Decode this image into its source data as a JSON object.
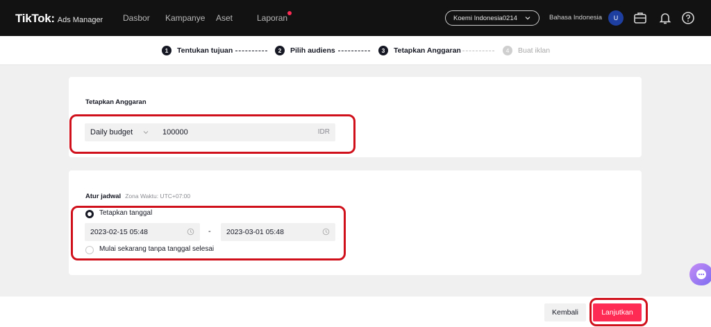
{
  "header": {
    "logo_main": "TikTok",
    "logo_colon": ":",
    "logo_sub": "Ads Manager",
    "nav": [
      "Dasbor",
      "Kampanye",
      "Aset",
      "Laporan"
    ],
    "account": "Koemi Indonesia0214",
    "language": "Bahasa Indonesia",
    "avatar_initial": "U",
    "icons": [
      "briefcase-icon",
      "bell-icon",
      "help-icon"
    ]
  },
  "steps": [
    {
      "num": "1",
      "label": "Tentukan tujuan",
      "active": true
    },
    {
      "num": "2",
      "label": "Pilih audiens",
      "active": true
    },
    {
      "num": "3",
      "label": "Tetapkan Anggaran",
      "active": true
    },
    {
      "num": "4",
      "label": "Buat iklan",
      "active": false
    }
  ],
  "budget": {
    "title": "Tetapkan Anggaran",
    "type": "Daily budget",
    "value": "100000",
    "currency": "IDR"
  },
  "schedule": {
    "title": "Atur jadwal",
    "timezone": "Zona Waktu: UTC+07:00",
    "option_set": "Tetapkan tanggal",
    "start": "2023-02-15 05:48",
    "separator": "-",
    "end": "2023-03-01 05:48",
    "option_continuous": "Mulai sekarang tanpa tanggal selesai"
  },
  "footer": {
    "back": "Kembali",
    "next": "Lanjutkan"
  },
  "colors": {
    "accent": "#fe2c55",
    "highlight": "#d0111c",
    "topbar": "#121212"
  }
}
